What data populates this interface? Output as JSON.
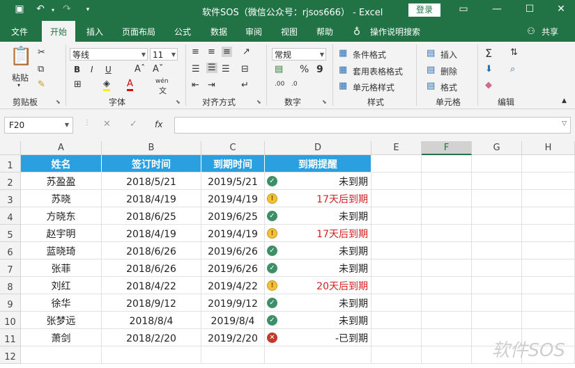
{
  "window": {
    "title": "软件SOS（微信公众号：rjsos666） - Excel",
    "login_label": "登录"
  },
  "tabs": [
    "文件",
    "开始",
    "插入",
    "页面布局",
    "公式",
    "数据",
    "审阅",
    "视图",
    "帮助"
  ],
  "tell_me": "操作说明搜索",
  "share": "共享",
  "ribbon": {
    "clipboard": {
      "paste": "粘贴",
      "label": "剪贴板"
    },
    "font": {
      "name": "等线",
      "size": "11",
      "label": "字体",
      "bold": "B",
      "italic": "I",
      "underline": "U",
      "wen": "wén",
      "wen2": "文"
    },
    "alignment": {
      "label": "对齐方式"
    },
    "number": {
      "format": "常规",
      "percent": "%",
      "comma": "9",
      "label": "数字"
    },
    "styles": {
      "conditional": "条件格式",
      "table": "套用表格格式",
      "cell": "单元格样式",
      "label": "样式"
    },
    "cells": {
      "insert": "插入",
      "delete": "删除",
      "format": "格式",
      "label": "单元格"
    },
    "editing": {
      "label": "编辑"
    }
  },
  "formula_bar": {
    "name_box": "F20",
    "fx": "fx",
    "value": ""
  },
  "sheet": {
    "columns": [
      "A",
      "B",
      "C",
      "D",
      "E",
      "F",
      "G",
      "H"
    ],
    "selected_column": "F",
    "rows": [
      "1",
      "2",
      "3",
      "4",
      "5",
      "6",
      "7",
      "8",
      "9",
      "10",
      "11",
      "12"
    ],
    "headers": [
      "姓名",
      "签订时间",
      "到期时间",
      "到期提醒"
    ],
    "data": [
      {
        "name": "苏盈盈",
        "signed": "2018/5/21",
        "due": "2019/5/21",
        "status": "ok",
        "remind": "未到期"
      },
      {
        "name": "苏晓",
        "signed": "2018/4/19",
        "due": "2019/4/19",
        "status": "warn",
        "remind": "17天后到期"
      },
      {
        "name": "方晓东",
        "signed": "2018/6/25",
        "due": "2019/6/25",
        "status": "ok",
        "remind": "未到期"
      },
      {
        "name": "赵宇明",
        "signed": "2018/4/19",
        "due": "2019/4/19",
        "status": "warn",
        "remind": "17天后到期"
      },
      {
        "name": "蓝晓琦",
        "signed": "2018/6/26",
        "due": "2019/6/26",
        "status": "ok",
        "remind": "未到期"
      },
      {
        "name": "张菲",
        "signed": "2018/6/26",
        "due": "2019/6/26",
        "status": "ok",
        "remind": "未到期"
      },
      {
        "name": "刘红",
        "signed": "2018/4/22",
        "due": "2019/4/22",
        "status": "warn",
        "remind": "20天后到期"
      },
      {
        "name": "徐华",
        "signed": "2018/9/12",
        "due": "2019/9/12",
        "status": "ok",
        "remind": "未到期"
      },
      {
        "name": "张梦远",
        "signed": "2018/8/4",
        "due": "2019/8/4",
        "status": "ok",
        "remind": "未到期"
      },
      {
        "name": "萧剑",
        "signed": "2018/2/20",
        "due": "2019/2/20",
        "status": "bad",
        "remind": "-已到期"
      }
    ]
  },
  "colors": {
    "accent": "#217346",
    "header_fill": "#2aa0e0",
    "warning_text": "#d21f1f"
  },
  "watermark": "软件SOS"
}
